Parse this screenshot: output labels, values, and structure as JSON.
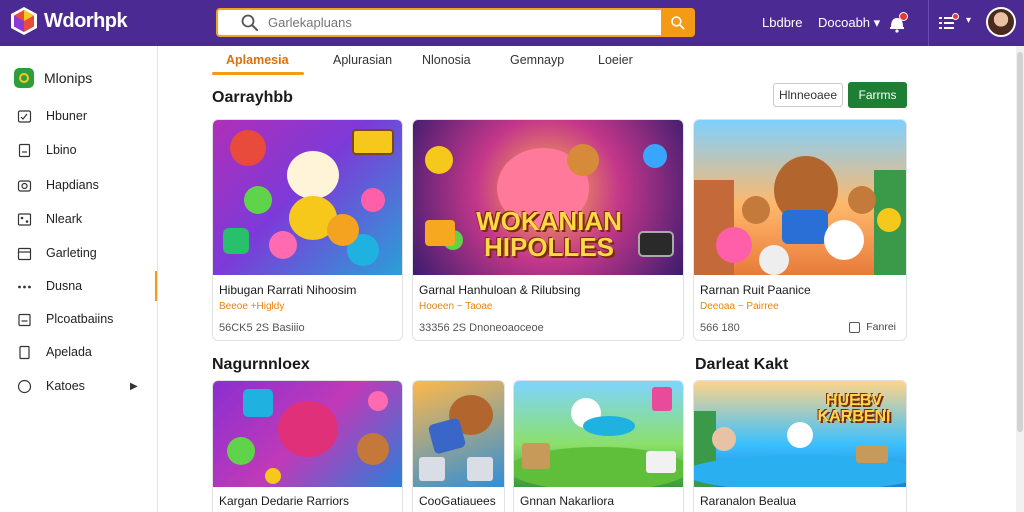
{
  "header": {
    "brand": "Wdorhpk",
    "search_placeholder": "Garlekapluans",
    "nav": [
      "Lbdbre",
      "Docoabh"
    ],
    "colors": {
      "bar": "#4b2a93",
      "accent": "#f39a16"
    }
  },
  "sidebar": {
    "title": "Mlonips",
    "items": [
      {
        "label": "Hbuner",
        "icon": "image-edit-icon"
      },
      {
        "label": "Lbino",
        "icon": "document-icon"
      },
      {
        "label": "Hapdians",
        "icon": "camera-icon"
      },
      {
        "label": "Nleark",
        "icon": "network-icon"
      },
      {
        "label": "Garleting",
        "icon": "calendar-icon"
      },
      {
        "label": "Dusna",
        "icon": "dots-icon"
      },
      {
        "label": "Plcoatbaiins",
        "icon": "clipboard-icon"
      },
      {
        "label": "Apelada",
        "icon": "page-icon"
      },
      {
        "label": "Katoes",
        "icon": "circle-icon"
      }
    ]
  },
  "tabs": [
    "Aplamesia",
    "Aplurasian",
    "Nlonosia",
    "Gemnayp",
    "Loeier"
  ],
  "main": {
    "section1": {
      "title": "Oarrayhbb",
      "btn_secondary": "Hlnneoaee",
      "btn_primary": "Farrms"
    },
    "section2": {
      "title_left": "Nagurnnloex",
      "title_right": "Darleat Kakt"
    },
    "featured": [
      {
        "title": "Hibugan Rarrati Nihoosim",
        "meta": "Beeoe +Higldy",
        "stats": "56CK5 2S  Basiiio",
        "extra": ""
      },
      {
        "title": "Garnal Hanhuloan & Rilubsing",
        "meta": "Hooeen ~ Taoae",
        "stats": "33356 2S  Dnoneoaoceoe",
        "extra": "",
        "wordmark_lines": [
          "WOKANIAN",
          "HIPOLLES"
        ]
      },
      {
        "title": "Rarnan Ruit Paanice",
        "meta": "Deeoaa ~ Pairree",
        "stats": "566 180",
        "extra": "Fanrei"
      }
    ],
    "row2": [
      {
        "title": "Kargan Dedarie Rarriors"
      },
      {
        "title": "CooGatiauees"
      },
      {
        "title": "Gnnan Nakarliora"
      },
      {
        "title": "Raranalon Bealua",
        "wordmark_lines": [
          "HUEBV",
          "KARBENI"
        ]
      }
    ]
  }
}
